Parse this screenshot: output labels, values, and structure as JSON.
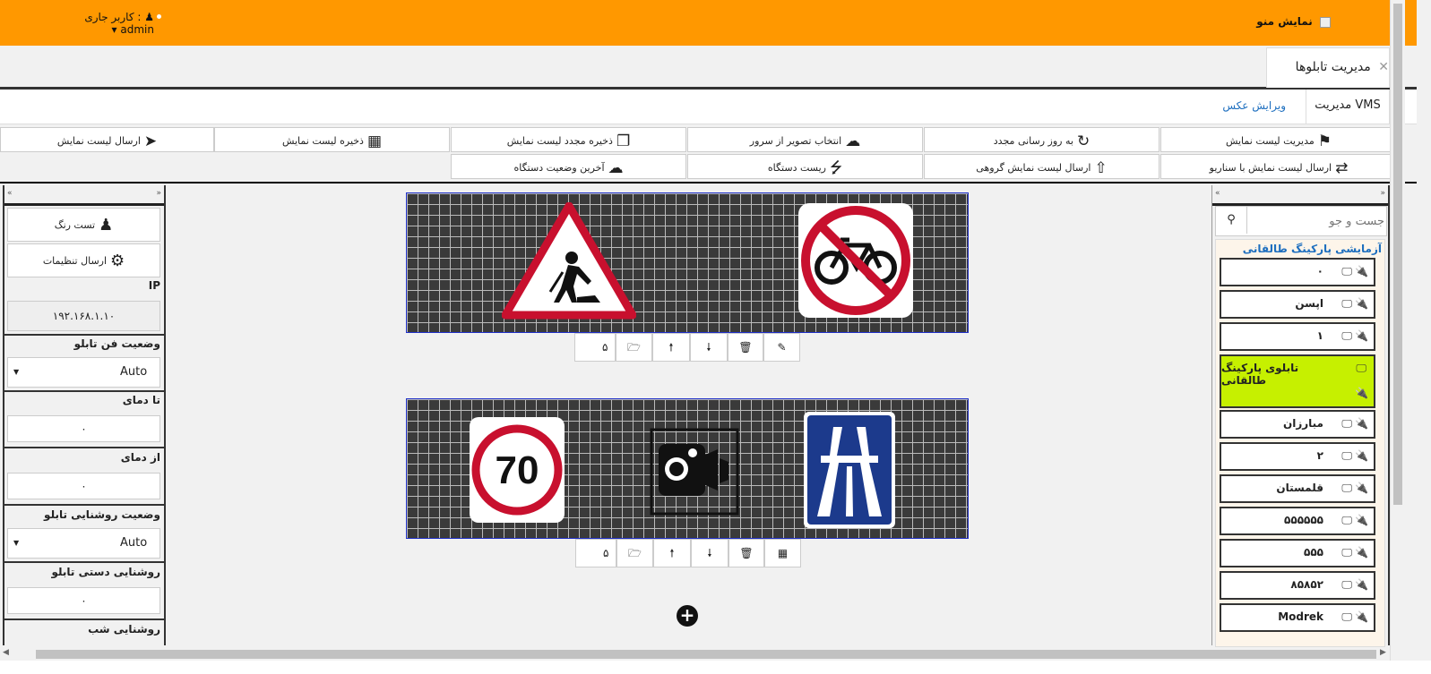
{
  "header": {
    "menu_toggle_label": "نمایش منو",
    "current_user_label": "کاربر جاری :",
    "username": "admin"
  },
  "tabs": {
    "main_tab_label": "مدیریت تابلوها",
    "vms_tab_label": "مدیریت VMS",
    "edit_photo_tab_label": "ویرایش عکس"
  },
  "toolbar": {
    "row1": [
      {
        "label": "مدیریت لیست نمایش",
        "icon": "tag-icon"
      },
      {
        "label": "به روز رسانی مجدد",
        "icon": "refresh-icon"
      },
      {
        "label": "انتخاب تصویر از سرور",
        "icon": "cloud-download-icon"
      },
      {
        "label": "ذخیره مجدد لیست نمایش",
        "icon": "copy-icon"
      },
      {
        "label": "ذخیره لیست نمایش",
        "icon": "save-icon"
      },
      {
        "label": "ارسال لیست نمایش",
        "icon": "paper-plane-icon"
      }
    ],
    "row2": [
      {
        "label": "ارسال لیست نمایش با سناریو",
        "icon": "shuffle-icon"
      },
      {
        "label": "ارسال لیست نمایش گروهی",
        "icon": "upload-icon"
      },
      {
        "label": "ریست دستگاه",
        "icon": "bolt-icon"
      },
      {
        "label": "آخرین وضعیت دستگاه",
        "icon": "cloud-download-icon"
      }
    ]
  },
  "device_panel": {
    "search_placeholder": "جست و جو",
    "group_title": "آزمایشی پارکینگ طالقانی",
    "devices": [
      {
        "name": "۰",
        "status": "disconnected"
      },
      {
        "name": "اپسن",
        "status": "disconnected"
      },
      {
        "name": "۱",
        "status": "disconnected"
      },
      {
        "name": "تابلوی پارکینگ طالقانی",
        "status": "disconnected",
        "selected": true
      },
      {
        "name": "مبارزان",
        "status": "disconnected"
      },
      {
        "name": "۲",
        "status": "disconnected"
      },
      {
        "name": "قلمستان",
        "status": "disconnected"
      },
      {
        "name": "۵۵۵۵۵۵",
        "status": "connected"
      },
      {
        "name": "۵۵۵",
        "status": "disconnected"
      },
      {
        "name": "۸۵۸۵۲",
        "status": "disconnected"
      },
      {
        "name": "Modrek",
        "status": "connected"
      }
    ]
  },
  "settings_panel": {
    "color_test_label": "تست رنگ",
    "send_settings_label": "ارسال تنظیمات",
    "ip_label": "IP",
    "ip_value": "۱۹۲.۱۶۸.۱.۱۰",
    "fan_status_label": "وضعیت فن تابلو",
    "fan_status_value": "Auto",
    "to_temp_label": "تا دمای",
    "to_temp_value": "۰",
    "from_temp_label": "از دمای",
    "from_temp_value": "۰",
    "brightness_status_label": "وضعیت روشنایی تابلو",
    "brightness_status_value": "Auto",
    "manual_brightness_label": "روشنایی دستی تابلو",
    "manual_brightness_value": "۰",
    "night_brightness_label": "روشنایی شب"
  },
  "playlist": {
    "items": [
      {
        "duration": "۵",
        "signs": [
          "road-works-sign",
          "no-bicycles-sign"
        ]
      },
      {
        "duration": "۵",
        "signs": [
          "speed-limit-70-sign",
          "speed-camera-sign",
          "motorway-sign"
        ]
      }
    ],
    "speed_limit_text": "70"
  },
  "colors": {
    "header": "#ff9800",
    "selected_device": "#c6f000",
    "link": "#1e6fbf",
    "disconnected": "#e02020",
    "connected": "#2a9a2a"
  }
}
